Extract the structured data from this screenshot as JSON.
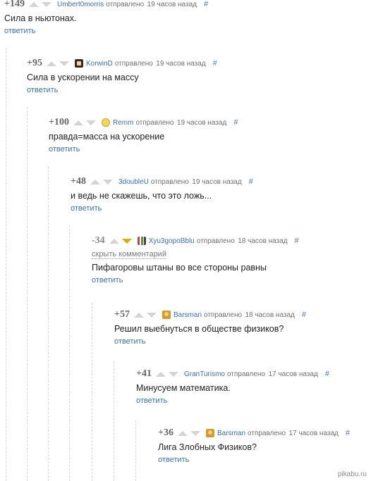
{
  "ui": {
    "sent_label": "отправлено",
    "reply_label": "ответить",
    "hash": "#",
    "hide_label": "скрыть комментарий"
  },
  "comments": [
    {
      "score": "+149",
      "author": "Umbert0morris",
      "time": "19 часов назад",
      "text": "Сила в ньютонах.",
      "avatar": "none"
    },
    {
      "score": "+95",
      "author": "KorwinD",
      "time": "19 часов назад",
      "text": "Сила в ускорении на массу",
      "avatar": "korwin"
    },
    {
      "score": "+100",
      "author": "Remm",
      "time": "19 часов назад",
      "text": "правда=масса на ускорение",
      "avatar": "smiley"
    },
    {
      "score": "+48",
      "author": "3doubleU",
      "time": "19 часов назад",
      "text": "и ведь не скажешь, что это ложь...",
      "avatar": "none"
    },
    {
      "score": "-34",
      "author": "Xyu3gopoBblu",
      "time": "18 часов назад",
      "text": "Пифагоровы штаны во все стороны равны",
      "avatar": "xyu",
      "downvoted": true
    },
    {
      "score": "+57",
      "author": "Barsman",
      "time": "18 часов назад",
      "text": "Решил выебнуться в обществе физиков?",
      "avatar": "barsman"
    },
    {
      "score": "+41",
      "author": "GranTurismo",
      "time": "17 часов назад",
      "text": "Минусуем математика.",
      "avatar": "none"
    },
    {
      "score": "+36",
      "author": "Barsman",
      "time": "17 часов назад",
      "text": "Лига Злобных Физиков?",
      "avatar": "barsman"
    }
  ],
  "watermark": "pikabu.ru",
  "colors": {
    "link": "#3b6fb0",
    "downvote_active": "#e1a800",
    "arrow_inactive": "#d4d4d4"
  }
}
